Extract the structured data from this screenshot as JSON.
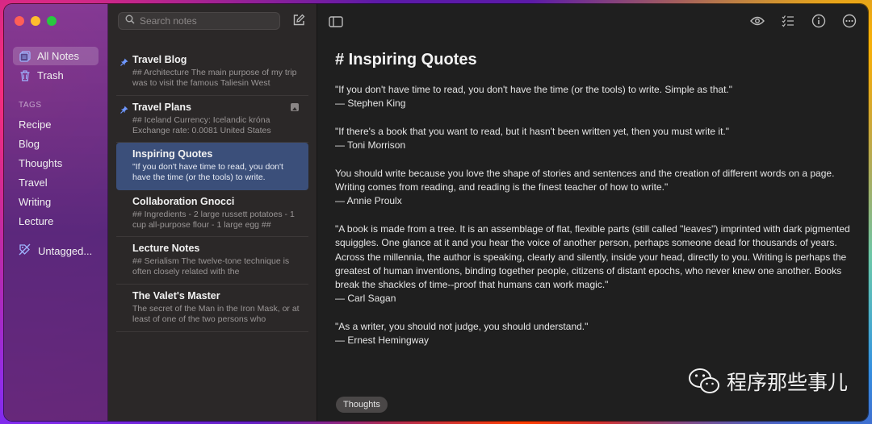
{
  "sidebar": {
    "nav": [
      {
        "label": "All Notes",
        "icon": "notes-icon",
        "active": true
      },
      {
        "label": "Trash",
        "icon": "trash-icon",
        "active": false
      }
    ],
    "tags_header": "TAGS",
    "tags": [
      "Recipe",
      "Blog",
      "Thoughts",
      "Travel",
      "Writing",
      "Lecture"
    ],
    "untagged": "Untagged..."
  },
  "notes_list": {
    "search_placeholder": "Search notes",
    "notes": [
      {
        "title": "Travel Blog",
        "snippet": "## Architecture The main purpose of my trip was to visit the famous Taliesin West",
        "pinned": true
      },
      {
        "title": "Travel Plans",
        "snippet": "## Iceland Currency: Icelandic króna Exchange rate: 0.0081 United States",
        "pinned": true
      },
      {
        "title": "Inspiring Quotes",
        "snippet": "\"If you don't have time to read, you don't have the time (or the tools) to write.",
        "pinned": false
      },
      {
        "title": "Collaboration Gnocci",
        "snippet": "## Ingredients - 2 large russett potatoes - 1 cup all-purpose flour - 1 large egg ##",
        "pinned": false
      },
      {
        "title": "Lecture Notes",
        "snippet": "## Serialism The twelve-tone technique is often closely related with the",
        "pinned": false
      },
      {
        "title": "The Valet's Master",
        "snippet": "The secret of the Man in the Iron Mask, or at least of one of the two persons who",
        "pinned": false
      }
    ]
  },
  "editor": {
    "title": "# Inspiring Quotes",
    "paragraphs": [
      {
        "quote": "\"If you don't have time to read, you don't have the time (or the tools) to write. Simple as that.\"",
        "author": "— Stephen King"
      },
      {
        "quote": "\"If there's a book that you want to read, but it hasn't been written yet, then you must write it.\"",
        "author": "— Toni Morrison"
      },
      {
        "quote": "You should write because you love the shape of stories and sentences and the creation of different words on a page. Writing comes from reading, and reading is the finest teacher of how to write.\"",
        "author": "— Annie Proulx"
      },
      {
        "quote": "\"A book is made from a tree. It is an assemblage of flat, flexible parts (still called \"leaves\") imprinted with dark pigmented squiggles. One glance at it and you hear the voice of another person, perhaps someone dead for thousands of years. Across the millennia, the author is speaking, clearly and silently, inside your head, directly to you. Writing is perhaps the greatest of human inventions, binding together people, citizens of distant epochs, who never knew one another. Books break the shackles of time--proof that humans can work magic.\"",
        "author": "— Carl Sagan"
      },
      {
        "quote": "\"As a writer, you should not judge, you should understand.\"",
        "author": "— Ernest Hemingway"
      }
    ],
    "tag_chip": "Thoughts",
    "toolbar_icons": [
      "eye-icon",
      "checklist-icon",
      "info-icon",
      "more-icon"
    ]
  },
  "watermark": "程序那些事儿",
  "colors": {
    "selected_note": "#3b4f7a",
    "editor_bg": "#1f1f1f",
    "notes_bg": "#2b2828",
    "close": "#ff5f57",
    "minimize": "#febc2e",
    "zoom": "#28c840"
  }
}
